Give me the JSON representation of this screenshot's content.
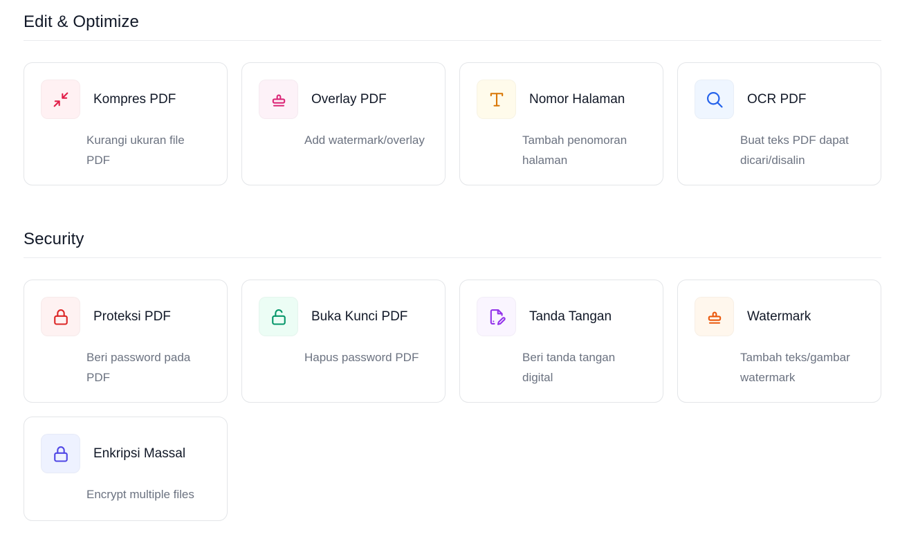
{
  "sections": {
    "edit": {
      "title": "Edit & Optimize",
      "cards": [
        {
          "title": "Kompres PDF",
          "desc": "Kurangi ukuran file PDF",
          "icon": "compress-icon",
          "color": "#e11d48",
          "bg": "#fff1f3"
        },
        {
          "title": "Overlay PDF",
          "desc": "Add watermark/overlay",
          "icon": "stamp-icon",
          "color": "#db2777",
          "bg": "#fdf2f8"
        },
        {
          "title": "Nomor Halaman",
          "desc": "Tambah penomoran halaman",
          "icon": "type-icon",
          "color": "#d97706",
          "bg": "#fffbeb"
        },
        {
          "title": "OCR PDF",
          "desc": "Buat teks PDF dapat dicari/disalin",
          "icon": "search-icon",
          "color": "#2563eb",
          "bg": "#eff6ff"
        }
      ]
    },
    "security": {
      "title": "Security",
      "cards": [
        {
          "title": "Proteksi PDF",
          "desc": "Beri password pada PDF",
          "icon": "lock-icon",
          "color": "#dc2626",
          "bg": "#fef2f2"
        },
        {
          "title": "Buka Kunci PDF",
          "desc": "Hapus password PDF",
          "icon": "unlock-icon",
          "color": "#059669",
          "bg": "#ecfdf5"
        },
        {
          "title": "Tanda Tangan",
          "desc": "Beri tanda tangan digital",
          "icon": "signature-icon",
          "color": "#9333ea",
          "bg": "#faf5ff"
        },
        {
          "title": "Watermark",
          "desc": "Tambah teks/gambar watermark",
          "icon": "stamp-icon",
          "color": "#ea580c",
          "bg": "#fff7ed"
        },
        {
          "title": "Enkripsi Massal",
          "desc": "Encrypt multiple files",
          "icon": "lock-icon",
          "color": "#4f46e5",
          "bg": "#eef2ff"
        }
      ]
    }
  }
}
